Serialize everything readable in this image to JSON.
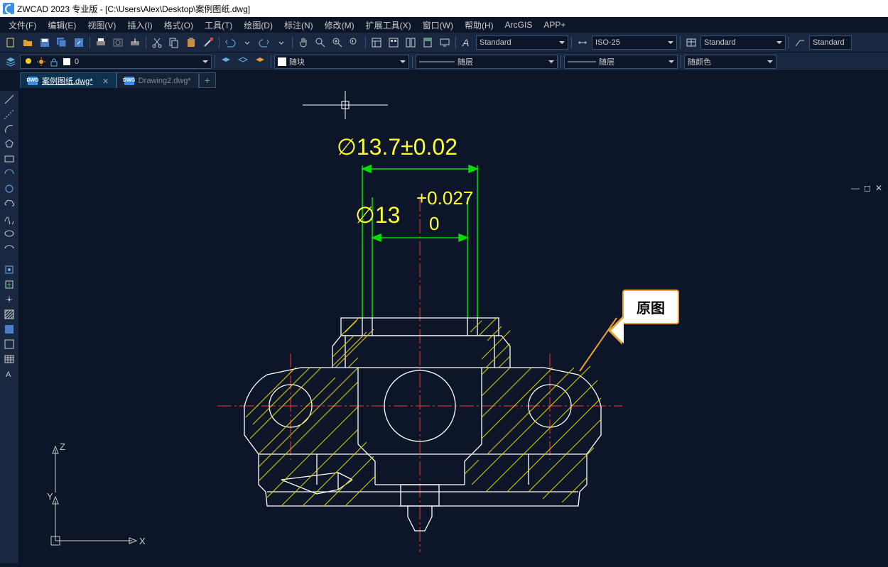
{
  "title": "ZWCAD 2023 专业版 - [C:\\Users\\Alex\\Desktop\\案例图纸.dwg]",
  "menus": [
    "文件(F)",
    "编辑(E)",
    "视图(V)",
    "插入(I)",
    "格式(O)",
    "工具(T)",
    "绘图(D)",
    "标注(N)",
    "修改(M)",
    "扩展工具(X)",
    "窗口(W)",
    "帮助(H)",
    "ArcGIS",
    "APP+"
  ],
  "styleDropdowns": {
    "textStyle": "Standard",
    "dimStyle": "ISO-25",
    "tableStyle": "Standard",
    "mleaderStyle": "Standard"
  },
  "layerRow": {
    "layer": "0",
    "prop1": "随块",
    "prop2": "随层",
    "prop3": "随层",
    "prop4": "随颜色"
  },
  "tabs": [
    {
      "label": "案例图纸.dwg*",
      "active": true
    },
    {
      "label": "Drawing2.dwg*",
      "active": false
    }
  ],
  "dims": {
    "d1": "∅13.7±0.02",
    "d2_main": "∅13",
    "d2_upper": "+0.027",
    "d2_lower": "0"
  },
  "callout": "原图",
  "ucsLabels": {
    "x": "X",
    "y": "Y",
    "z": "Z"
  }
}
